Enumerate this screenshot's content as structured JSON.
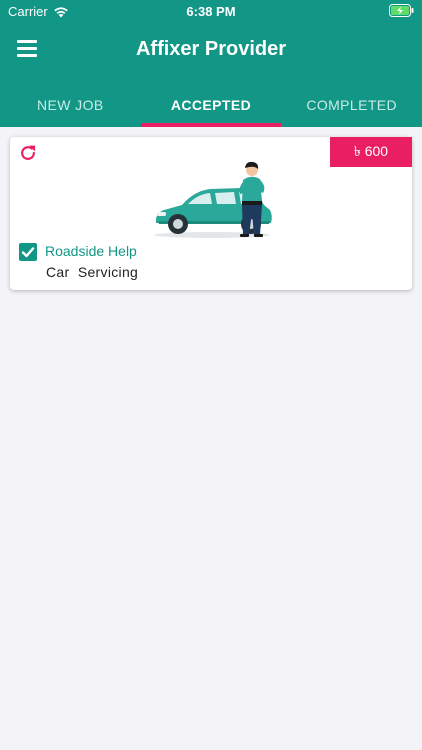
{
  "status_bar": {
    "carrier": "Carrier",
    "time": "6:38 PM"
  },
  "header": {
    "title": "Affixer Provider",
    "menu_icon": "hamburger-menu-icon"
  },
  "tabs": [
    {
      "label": "NEW JOB",
      "active": false
    },
    {
      "label": "ACCEPTED",
      "active": true
    },
    {
      "label": "COMPLETED",
      "active": false
    }
  ],
  "job_card": {
    "price": "৳ 600",
    "checked": true,
    "service_name": "Roadside Help",
    "service_type": "Car  Servicing"
  },
  "colors": {
    "primary": "#129787",
    "accent": "#e91e63",
    "background": "#f4f4f8"
  }
}
